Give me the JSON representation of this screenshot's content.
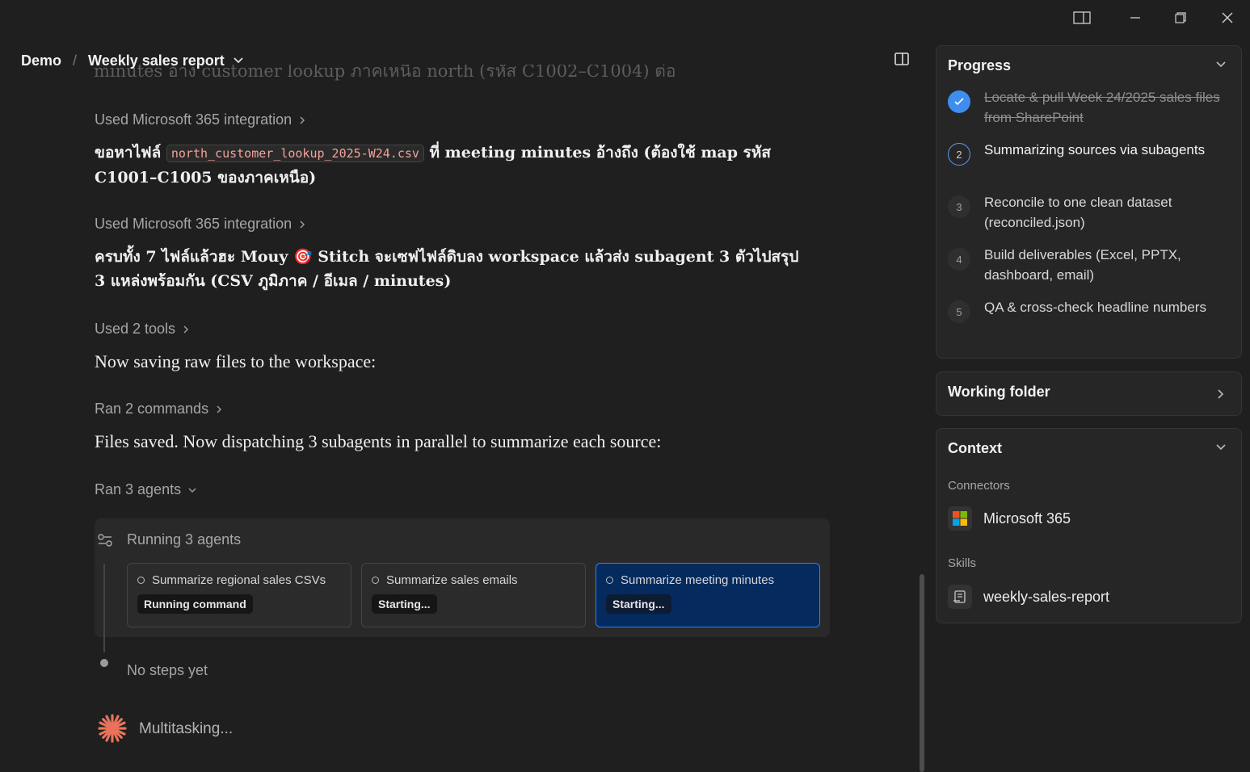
{
  "header": {
    "workspace": "Demo",
    "separator": "/",
    "title": "Weekly sales report"
  },
  "chat": {
    "faded_text": "minutes อ้าง customer lookup ภาคเหนือ north (รหัส C1002–C1004) ต่อ",
    "tool1_label": "Used Microsoft 365 integration",
    "msg1_before": "ขอหาไฟล์ ",
    "msg1_code": "north_customer_lookup_2025-W24.csv",
    "msg1_after": " ที่ meeting minutes อ้างถึง (ต้องใช้ map รหัส C1001–C1005 ของภาคเหนือ)",
    "tool2_label": "Used Microsoft 365 integration",
    "msg2_text": "ครบทั้ง 7 ไฟล์แล้วฮะ Mouy 🎯 Stitch จะเซฟไฟล์ดิบลง workspace แล้วส่ง subagent 3 ตัวไปสรุป 3 แหล่งพร้อมกัน (CSV ภูมิภาค / อีเมล / minutes)",
    "tool3_label": "Used 2 tools",
    "msg3_text": "Now saving raw files to the workspace:",
    "tool4_label": "Ran 2 commands",
    "msg4_text": "Files saved. Now dispatching 3 subagents in parallel to summarize each source:",
    "tool5_label": "Ran 3 agents"
  },
  "agents": {
    "header": "Running 3 agents",
    "cards": [
      {
        "title": "Summarize regional sales CSVs",
        "status": "Running command"
      },
      {
        "title": "Summarize sales emails",
        "status": "Starting..."
      },
      {
        "title": "Summarize meeting minutes",
        "status": "Starting..."
      }
    ],
    "no_steps": "No steps yet"
  },
  "status": {
    "text": "Multitasking..."
  },
  "progress": {
    "title": "Progress",
    "steps": [
      {
        "num": "",
        "label": "Locate & pull Week 24/2025 sales files from SharePoint",
        "state": "done"
      },
      {
        "num": "2",
        "label": "Summarizing sources via subagents",
        "state": "active"
      },
      {
        "num": "3",
        "label": "Reconcile to one clean dataset (reconciled.json)",
        "state": "pending"
      },
      {
        "num": "4",
        "label": "Build deliverables (Excel, PPTX, dashboard, email)",
        "state": "pending"
      },
      {
        "num": "5",
        "label": "QA & cross-check headline numbers",
        "state": "pending"
      }
    ]
  },
  "working_folder": {
    "title": "Working folder"
  },
  "context": {
    "title": "Context",
    "connectors_label": "Connectors",
    "connector": "Microsoft 365",
    "skills_label": "Skills",
    "skill": "weekly-sales-report"
  },
  "colors": {
    "background": "#1f1f1f",
    "accent_blue": "#3d8ef0",
    "selected_card": "#052a5e",
    "code_text": "#f3a29a",
    "spinner": "#e8735a"
  }
}
